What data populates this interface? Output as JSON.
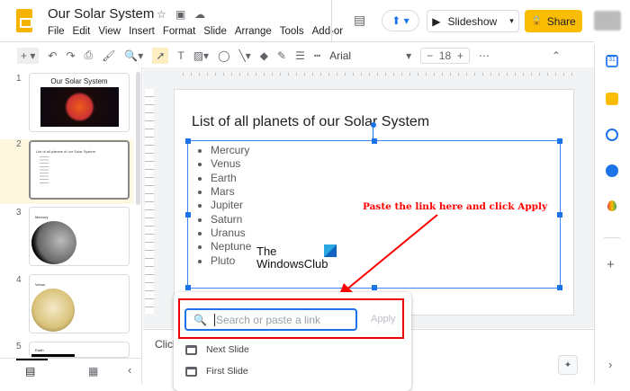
{
  "header": {
    "title": "Our Solar System",
    "menu": [
      "File",
      "Edit",
      "View",
      "Insert",
      "Format",
      "Slide",
      "Arrange",
      "Tools",
      "Add-or"
    ],
    "slideshow": "Slideshow",
    "share": "Share"
  },
  "toolbar": {
    "font": "Arial",
    "font_size": "18"
  },
  "filmstrip": {
    "slides": [
      {
        "num": "1",
        "title": "Our Solar System"
      },
      {
        "num": "2",
        "title": "List of all planets of our Solar System"
      },
      {
        "num": "3",
        "title": "Mercury"
      },
      {
        "num": "4",
        "title": "Venus"
      },
      {
        "num": "5",
        "title": "Earth"
      }
    ]
  },
  "slide": {
    "title": "List of all planets of our Solar System",
    "bullets": [
      "Mercury",
      "Venus",
      "Earth",
      "Mars",
      "Jupiter",
      "Saturn",
      "Uranus",
      "Neptune",
      "Pluto"
    ],
    "watermark": [
      "The",
      "WindowsClub"
    ]
  },
  "annotation": "Paste the link here and click Apply",
  "notes": {
    "text": "Click"
  },
  "link_popup": {
    "placeholder": "Search or paste a link",
    "apply": "Apply",
    "suggestions": [
      "Next Slide",
      "First Slide"
    ]
  },
  "colors": {
    "accent": "#1a73e8",
    "share": "#fbbc04",
    "annotation": "#ff0000"
  }
}
